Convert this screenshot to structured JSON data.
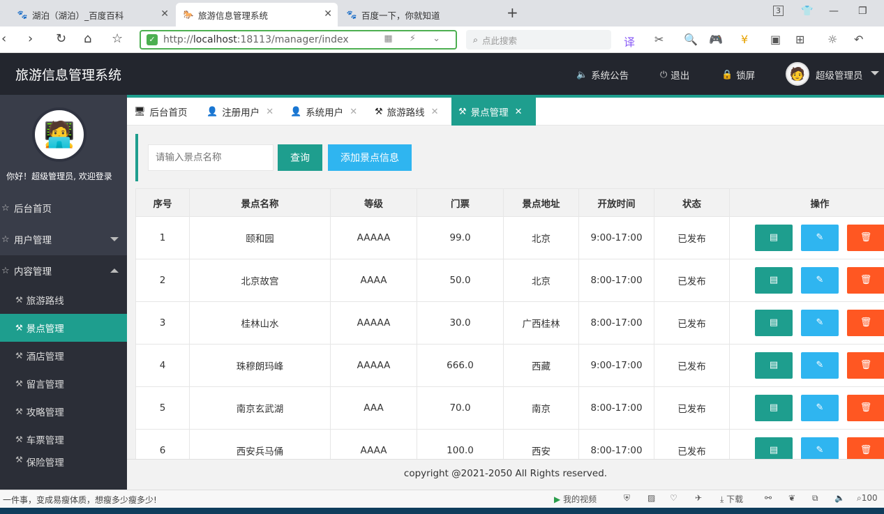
{
  "browser": {
    "tabs": [
      {
        "icon": "baidu-paw-icon",
        "label": "湖泊（湖泊）_百度百科"
      },
      {
        "icon": "site-icon",
        "label": "旅游信息管理系统"
      },
      {
        "icon": "baidu-paw-icon",
        "label": "百度一下，你就知道"
      }
    ],
    "tab_count": "3",
    "url_prefix": "http://",
    "url_host": "localhost",
    "url_rest": ":18113/manager/index",
    "search_placeholder": "点此搜索",
    "status_text": "一件事，变成易瘦体质，想瘦多少瘦多少!",
    "status_video": "我的视频",
    "status_download": "下载",
    "status_zoom": "100"
  },
  "header": {
    "title": "旅游信息管理系统",
    "notice": "系统公告",
    "logout": "退出",
    "lock": "锁屏",
    "user": "超级管理员"
  },
  "sidebar": {
    "welcome": "你好！超级管理员, 欢迎登录",
    "menu": [
      {
        "label": "后台首页"
      },
      {
        "label": "用户管理"
      },
      {
        "label": "内容管理"
      }
    ],
    "submenu": [
      {
        "label": "旅游路线"
      },
      {
        "label": "景点管理"
      },
      {
        "label": "酒店管理"
      },
      {
        "label": "留言管理"
      },
      {
        "label": "攻略管理"
      },
      {
        "label": "车票管理"
      },
      {
        "label": "保险管理"
      }
    ]
  },
  "content_tabs": [
    {
      "label": "后台首页"
    },
    {
      "label": "注册用户"
    },
    {
      "label": "系统用户"
    },
    {
      "label": "旅游路线"
    },
    {
      "label": "景点管理"
    }
  ],
  "search": {
    "placeholder": "请输入景点名称",
    "query_label": "查询",
    "add_label": "添加景点信息"
  },
  "table": {
    "headers": [
      "序号",
      "景点名称",
      "等级",
      "门票",
      "景点地址",
      "开放时间",
      "状态",
      "操作"
    ],
    "rows": [
      [
        "1",
        "颐和园",
        "AAAAA",
        "99.0",
        "北京",
        "9:00-17:00",
        "已发布"
      ],
      [
        "2",
        "北京故宫",
        "AAAA",
        "50.0",
        "北京",
        "8:00-17:00",
        "已发布"
      ],
      [
        "3",
        "桂林山水",
        "AAAAA",
        "30.0",
        "广西桂林",
        "8:00-17:00",
        "已发布"
      ],
      [
        "4",
        "珠穆朗玛峰",
        "AAAAA",
        "666.0",
        "西藏",
        "9:00-17:00",
        "已发布"
      ],
      [
        "5",
        "南京玄武湖",
        "AAA",
        "70.0",
        "南京",
        "8:00-17:00",
        "已发布"
      ],
      [
        "6",
        "西安兵马俑",
        "AAAA",
        "100.0",
        "西安",
        "8:00-17:00",
        "已发布"
      ]
    ]
  },
  "footer": "copyright @2021-2050 All Rights reserved."
}
